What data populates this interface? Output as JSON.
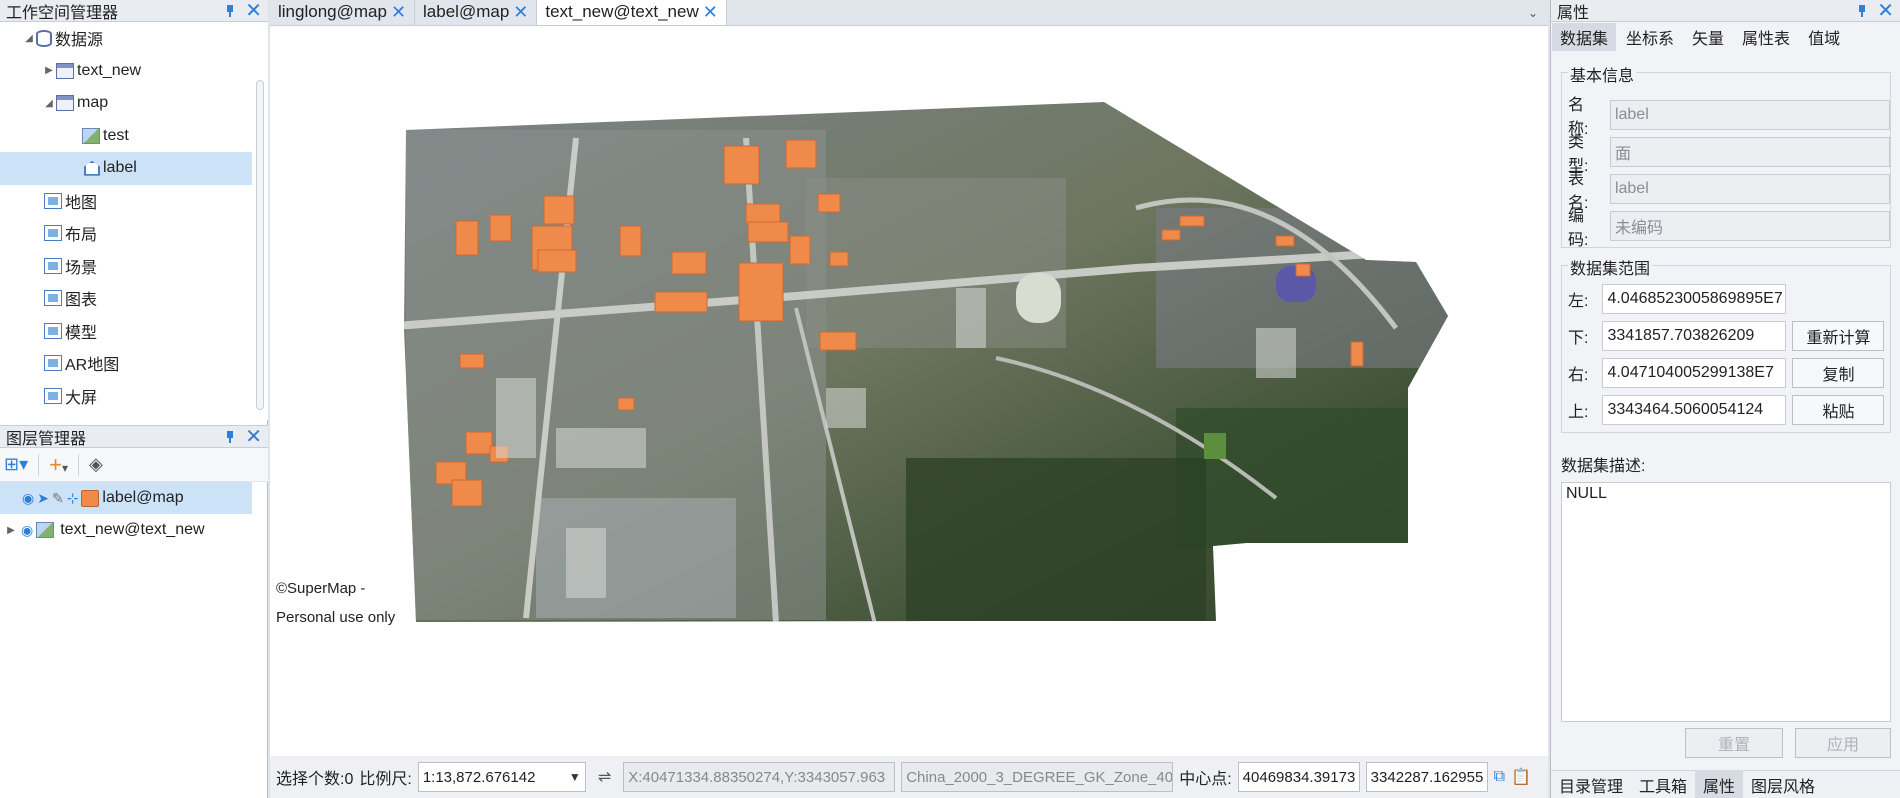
{
  "workspace": {
    "title": "工作空间管理器",
    "tree": [
      {
        "label": "数据源",
        "level": 0,
        "expanded": true,
        "icon": "datasource-icon"
      },
      {
        "label": "text_new",
        "level": 1,
        "expanded": false,
        "icon": "database-icon"
      },
      {
        "label": "map",
        "level": 1,
        "expanded": true,
        "icon": "database-icon"
      },
      {
        "label": "test",
        "level": 2,
        "icon": "image-dataset-icon"
      },
      {
        "label": "label",
        "level": 2,
        "icon": "polygon-dataset-icon",
        "selected": true
      },
      {
        "label": "地图",
        "level": 0,
        "icon": "map-icon"
      },
      {
        "label": "布局",
        "level": 0,
        "icon": "layout-icon"
      },
      {
        "label": "场景",
        "level": 0,
        "icon": "scene-icon"
      },
      {
        "label": "图表",
        "level": 0,
        "icon": "chart-icon"
      },
      {
        "label": "模型",
        "level": 0,
        "icon": "model-icon"
      },
      {
        "label": "AR地图",
        "level": 0,
        "icon": "ar-map-icon"
      },
      {
        "label": "大屏",
        "level": 0,
        "icon": "bigscreen-icon"
      }
    ]
  },
  "layers": {
    "title": "图层管理器",
    "items": [
      {
        "label": "label@map",
        "selected": true
      },
      {
        "label": "text_new@text_new",
        "selected": false
      }
    ]
  },
  "tabs": [
    {
      "label": "linglong@map",
      "active": false
    },
    {
      "label": "label@map",
      "active": false
    },
    {
      "label": "text_new@text_new",
      "active": true
    }
  ],
  "map": {
    "credit_line1": "©SuperMap -",
    "credit_line2": "Personal use only"
  },
  "status": {
    "selected_count_label": "选择个数:0",
    "scale_label": "比例尺:",
    "scale_value": "1:13,872.676142",
    "coords": "X:40471334.88350274,Y:3343057.963",
    "crs": "China_2000_3_DEGREE_GK_Zone_40",
    "center_label": "中心点:",
    "center_x": "40469834.39173",
    "center_y": "3342287.162955"
  },
  "properties": {
    "title": "属性",
    "tabs": [
      "数据集",
      "坐标系",
      "矢量",
      "属性表",
      "值域"
    ],
    "basic": {
      "title": "基本信息",
      "name_label": "名称:",
      "name_value": "label",
      "type_label": "类型:",
      "type_value": "面",
      "table_label": "表名:",
      "table_value": "label",
      "code_label": "编码:",
      "code_value": "未编码"
    },
    "bounds": {
      "title": "数据集范围",
      "left_label": "左:",
      "left_value": "4.0468523005869895E7",
      "bottom_label": "下:",
      "bottom_value": "3341857.703826209",
      "right_label": "右:",
      "right_value": "4.047104005299138E7",
      "top_label": "上:",
      "top_value": "3343464.5060054124",
      "recalc_button": "重新计算",
      "copy_button": "复制",
      "paste_button": "粘贴"
    },
    "desc_label": "数据集描述:",
    "desc_value": "NULL",
    "reset_button": "重置",
    "apply_button": "应用",
    "bottom_tabs": [
      "目录管理",
      "工具箱",
      "属性",
      "图层风格"
    ]
  }
}
